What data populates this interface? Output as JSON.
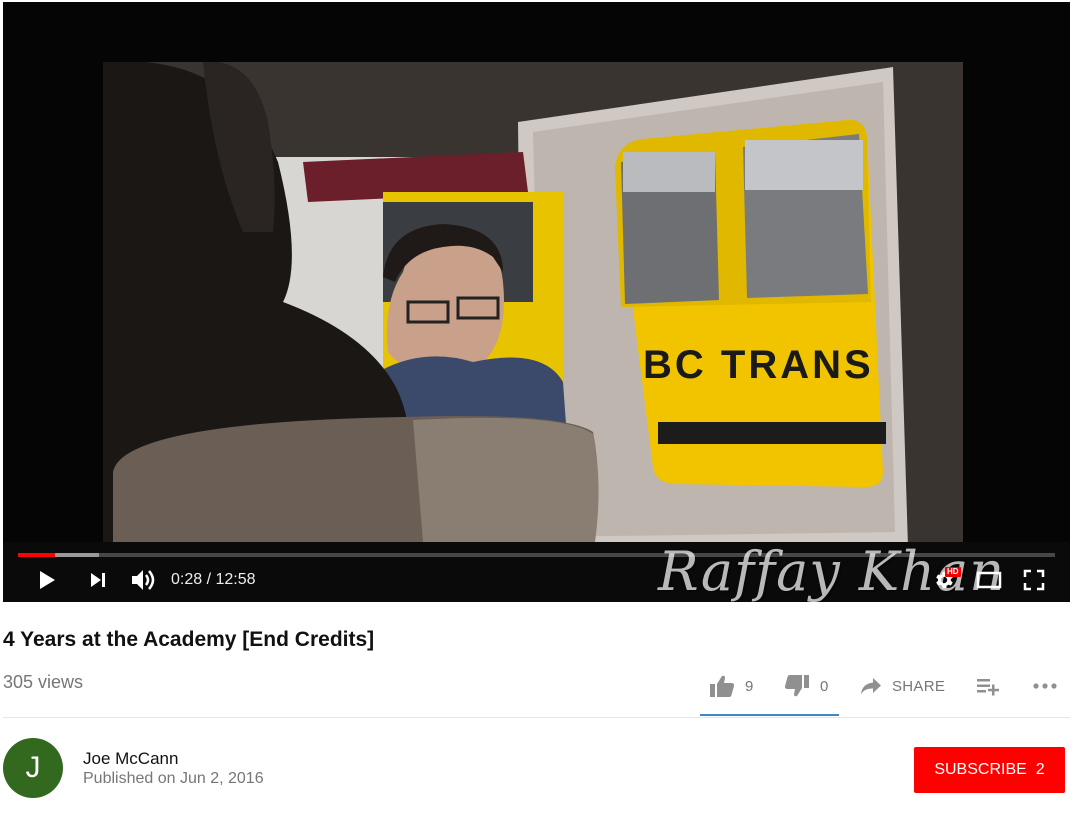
{
  "player": {
    "time_current": "0:28",
    "time_separator": " / ",
    "time_total": "12:58",
    "progress_played_fraction": 0.036,
    "progress_buffered_fraction": 0.078,
    "watermark_text": "Raffay Khan",
    "scene_text": "BC TRANS",
    "settings_badge": "HD",
    "icons": {
      "play": "play-icon",
      "next": "next-icon",
      "volume": "volume-icon",
      "settings": "gear-icon",
      "theater": "theater-mode-icon",
      "fullscreen": "fullscreen-icon"
    },
    "accent_color": "#ff0000"
  },
  "video": {
    "title": "4 Years at the Academy [End Credits]",
    "views": "305 views"
  },
  "actions": {
    "like_count": "9",
    "dislike_count": "0",
    "share_label": "SHARE",
    "like_fraction": 1.0,
    "icons": {
      "like": "thumbs-up-icon",
      "dislike": "thumbs-down-icon",
      "share": "share-arrow-icon",
      "add_to_playlist": "playlist-add-icon",
      "more": "more-horizontal-icon"
    }
  },
  "channel": {
    "avatar_letter": "J",
    "avatar_color": "#33691e",
    "name": "Joe McCann",
    "published": "Published on Jun 2, 2016",
    "subscribe_label": "SUBSCRIBE",
    "subscriber_count": "2",
    "subscribe_color": "#ff0000"
  }
}
